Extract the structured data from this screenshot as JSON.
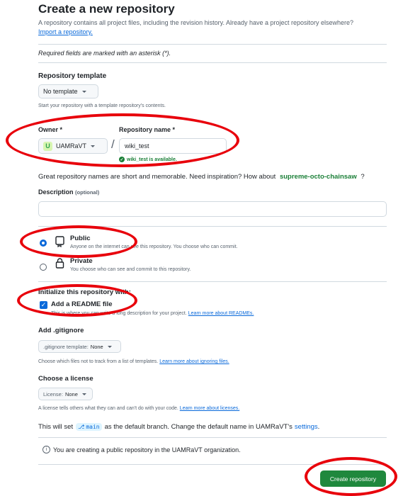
{
  "header": {
    "title": "Create a new repository",
    "subtitle": "A repository contains all project files, including the revision history. Already have a project repository elsewhere?",
    "import_link": "Import a repository."
  },
  "required_note": "Required fields are marked with an asterisk (*).",
  "template": {
    "label": "Repository template",
    "value": "No template",
    "help": "Start your repository with a template repository's contents."
  },
  "owner": {
    "label": "Owner *",
    "value": "UAMRaVT",
    "slash": "/"
  },
  "repo_name": {
    "label": "Repository name *",
    "value": "wiki_test",
    "status": "wiki_test is available."
  },
  "name_hint": {
    "text": "Great repository names are short and memorable. Need inspiration? How about",
    "suggestion": "supreme-octo-chainsaw",
    "end": "?"
  },
  "description": {
    "label": "Description",
    "optional": "(optional)",
    "value": ""
  },
  "visibility": {
    "public": {
      "title": "Public",
      "desc": "Anyone on the internet can see this repository. You choose who can commit.",
      "selected": true
    },
    "private": {
      "title": "Private",
      "desc": "You choose who can see and commit to this repository.",
      "selected": false
    }
  },
  "init": {
    "label": "Initialize this repository with:",
    "readme_title": "Add a README file",
    "readme_desc": "This is where you can write a long description for your project.",
    "readme_link": "Learn more about READMEs.",
    "readme_checked": true
  },
  "gitignore": {
    "label": "Add .gitignore",
    "button_prefix": ".gitignore template:",
    "button_value": "None",
    "help": "Choose which files not to track from a list of templates.",
    "help_link": "Learn more about ignoring files."
  },
  "license": {
    "label": "Choose a license",
    "button_prefix": "License:",
    "button_value": "None",
    "help": "A license tells others what they can and can't do with your code.",
    "help_link": "Learn more about licenses."
  },
  "branch_note": {
    "prefix": "This will set",
    "branch": "main",
    "middle": "as the default branch. Change the default name in UAMRaVT's",
    "link": "settings",
    "end": "."
  },
  "info": "You are creating a public repository in the UAMRaVT organization.",
  "submit": "Create repository",
  "colors": {
    "accent_green": "#1f883d",
    "link": "#0969da",
    "annotation_red": "#e8000b"
  }
}
